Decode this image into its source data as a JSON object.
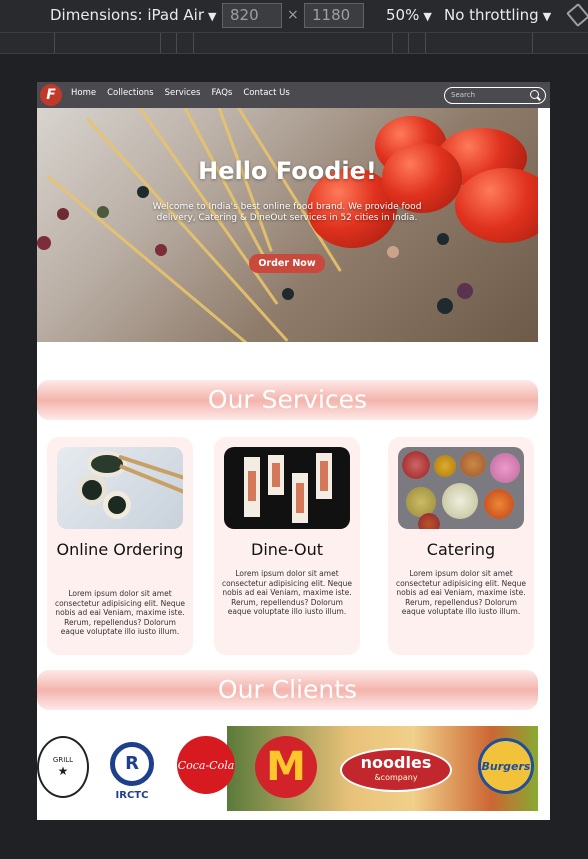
{
  "devtools": {
    "dimensions_label": "Dimensions: iPad Air",
    "width": "820",
    "height": "1180",
    "zoom": "50%",
    "throttling": "No throttling"
  },
  "site": {
    "logo_letter": "F",
    "nav": [
      "Home",
      "Collections",
      "Services",
      "FAQs",
      "Contact Us"
    ],
    "search_placeholder": "Search",
    "hero": {
      "title": "Hello Foodie!",
      "text": "Welcome to India's best online food brand. We provide food delivery, Catering & DineOut services in 52 cities in India.",
      "button": "Order Now"
    },
    "services_title": "Our Services",
    "services": [
      {
        "title": "Online Ordering",
        "text": "Lorem ipsum dolor sit amet consectetur adipisicing elit. Neque nobis ad eai Veniam, maxime iste. Rerum, repellendus? Dolorum eaque voluptate illo iusto illum."
      },
      {
        "title": "Dine-Out",
        "text": "Lorem ipsum dolor sit amet consectetur adipisicing elit. Neque nobis ad eai Veniam, maxime iste. Rerum, repellendus? Dolorum eaque voluptate illo iusto illum."
      },
      {
        "title": "Catering",
        "text": "Lorem ipsum dolor sit amet consectetur adipisicing elit. Neque nobis ad eai Veniam, maxime iste. Rerum, repellendus? Dolorum eaque voluptate illo iusto illum."
      }
    ],
    "clients_title": "Our Clients",
    "clients": {
      "grill": "GRILL",
      "irctc": "IRCTC",
      "cocacola": "Coca-Cola",
      "mcdonalds": "M",
      "noodles": "noodles",
      "noodles_sub": "&company",
      "burgers": "Burgers"
    },
    "colors": {
      "nav": "#4a4a4f",
      "accent": "#c94a3c",
      "banner": "#f4b4ad",
      "card": "#fdf0ef"
    }
  }
}
